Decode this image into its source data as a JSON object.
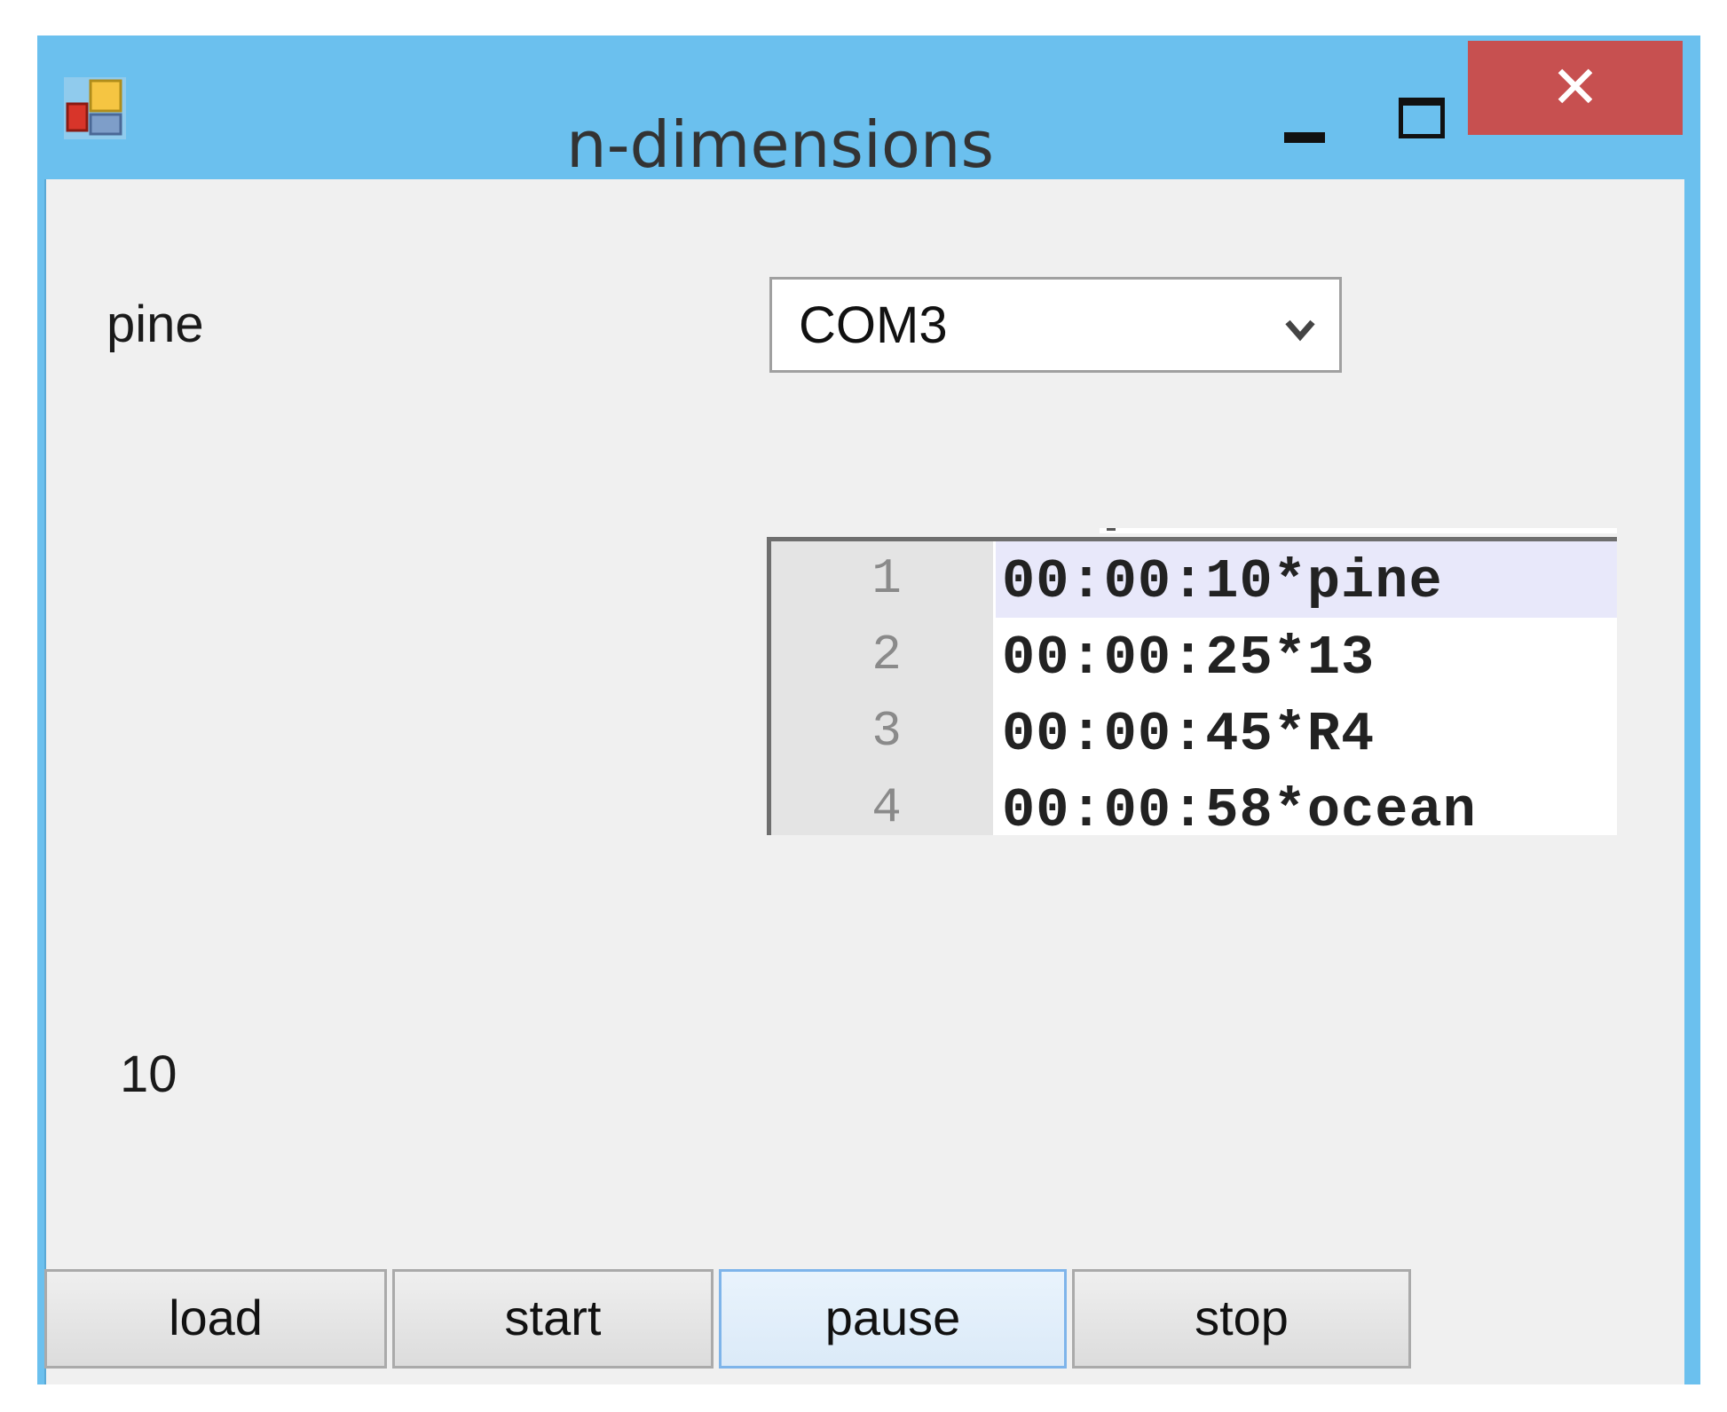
{
  "window": {
    "title": "n-dimensions",
    "icon": "app-window-icon",
    "controls": {
      "minimize": "minimize-icon",
      "maximize": "maximize-icon",
      "close_label": "✕"
    },
    "colors": {
      "titlebar": "#6bc0ee",
      "close": "#c75050",
      "client": "#f0f0f0"
    }
  },
  "labels": {
    "current_word": "pine",
    "counter": "10"
  },
  "port_select": {
    "value": "COM3"
  },
  "script_editor": {
    "lines": [
      {
        "number": "1",
        "text": "00:00:10*pine"
      },
      {
        "number": "2",
        "text": "00:00:25*13"
      },
      {
        "number": "3",
        "text": "00:00:45*R4"
      },
      {
        "number": "4",
        "text": "00:00:58*ocean"
      }
    ]
  },
  "buttons": {
    "load": "load",
    "start": "start",
    "pause": "pause",
    "stop": "stop"
  }
}
